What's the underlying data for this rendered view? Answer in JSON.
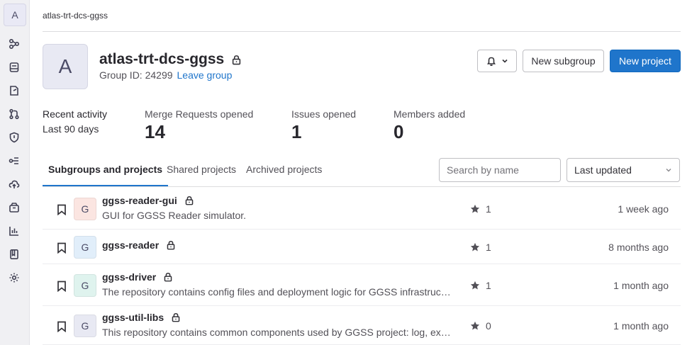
{
  "sidebar": {
    "avatar_letter": "A",
    "icons": [
      "overview-icon",
      "repository-icon",
      "code-icon",
      "issues-icon",
      "merge-requests-icon",
      "security-icon",
      "ci-cd-icon",
      "deploy-icon",
      "packages-icon",
      "analytics-icon",
      "wiki-icon",
      "settings-icon"
    ]
  },
  "breadcrumb": "atlas-trt-dcs-ggss",
  "group": {
    "avatar_letter": "A",
    "name": "atlas-trt-dcs-ggss",
    "id_text": "Group ID: 24299",
    "leave_label": "Leave group"
  },
  "actions": {
    "new_subgroup": "New subgroup",
    "new_project": "New project"
  },
  "stats": {
    "recent_label": "Recent activity",
    "recent_period": "Last 90 days",
    "merge_requests_label": "Merge Requests opened",
    "merge_requests_value": "14",
    "issues_label": "Issues opened",
    "issues_value": "1",
    "members_label": "Members added",
    "members_value": "0"
  },
  "tabs": [
    {
      "label": "Subgroups and projects",
      "active": true
    },
    {
      "label": "Shared projects",
      "active": false
    },
    {
      "label": "Archived projects",
      "active": false
    }
  ],
  "search": {
    "placeholder": "Search by name"
  },
  "sort": {
    "selected": "Last updated"
  },
  "projects": [
    {
      "letter": "G",
      "avatar_color": "#fbe5e1",
      "name": "ggss-reader-gui",
      "description": "GUI for GGSS Reader simulator.",
      "stars": "1",
      "updated": "1 week ago"
    },
    {
      "letter": "G",
      "avatar_color": "#e1eefa",
      "name": "ggss-reader",
      "description": "",
      "stars": "1",
      "updated": "8 months ago"
    },
    {
      "letter": "G",
      "avatar_color": "#dff3ee",
      "name": "ggss-driver",
      "description": "The repository contains config files and deployment logic for GGSS infrastrucu...",
      "stars": "1",
      "updated": "1 month ago"
    },
    {
      "letter": "G",
      "avatar_color": "#e8e9f3",
      "name": "ggss-util-libs",
      "description": "This repository contains common components used by GGSS project: log, exc...",
      "stars": "0",
      "updated": "1 month ago"
    }
  ]
}
